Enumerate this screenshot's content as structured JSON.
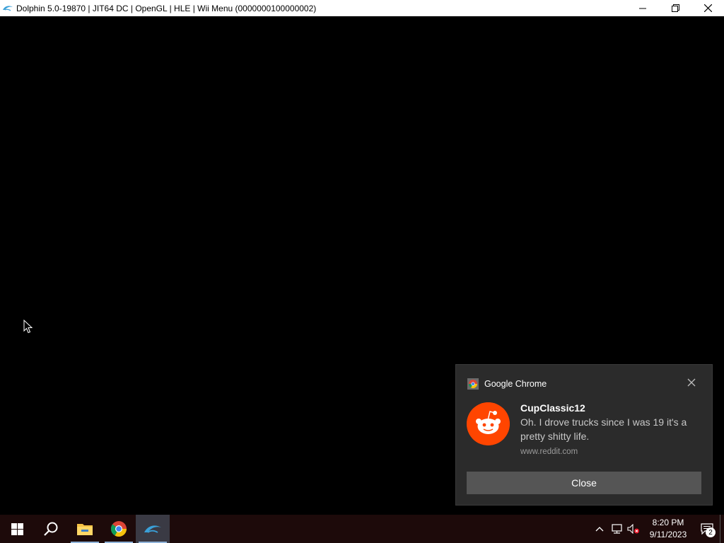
{
  "window": {
    "title": "Dolphin 5.0-19870 | JIT64 DC | OpenGL | HLE | Wii Menu (0000000100000002)"
  },
  "notification": {
    "app_name": "Google Chrome",
    "sender": "CupClassic12",
    "message": "Oh. I drove trucks since I was 19 it's a pretty shitty life.",
    "source": "www.reddit.com",
    "close_label": "Close",
    "avatar_color": "#ff4500"
  },
  "taskbar": {
    "time": "8:20 PM",
    "date": "9/11/2023",
    "notification_count": "2",
    "accent": "#8fb3d9"
  }
}
